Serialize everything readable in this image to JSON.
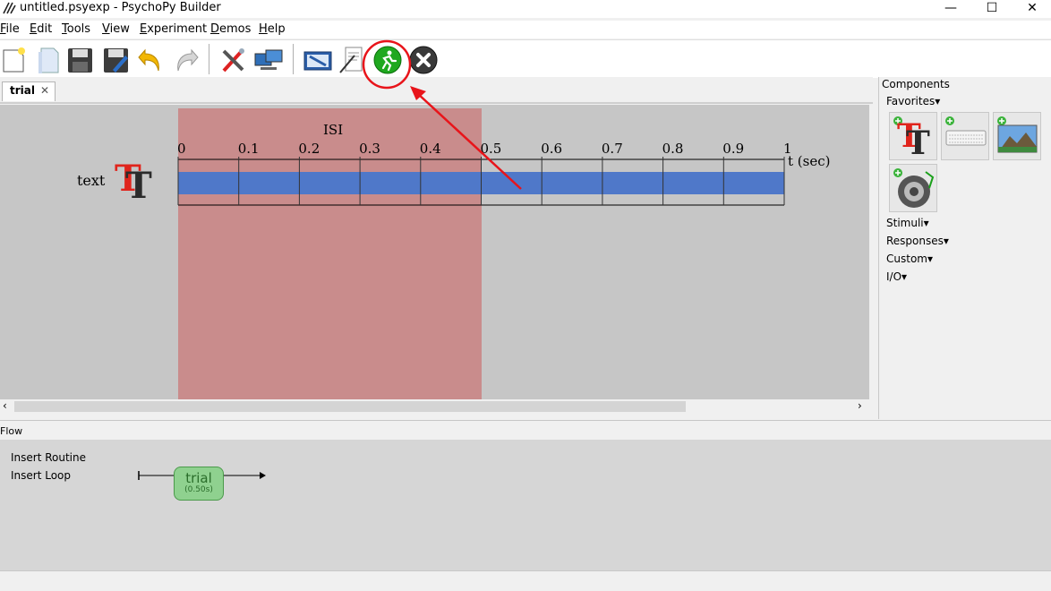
{
  "window": {
    "title": "untitled.psyexp - PsychoPy Builder",
    "minimize": "—",
    "maximize": "☐",
    "close": "✕"
  },
  "menu": [
    {
      "label": "File",
      "ul": "F",
      "rest": "ile"
    },
    {
      "label": "Edit",
      "ul": "E",
      "rest": "dit"
    },
    {
      "label": "Tools",
      "ul": "T",
      "rest": "ools"
    },
    {
      "label": "View",
      "ul": "V",
      "rest": "iew"
    },
    {
      "label": "Experiment",
      "ul": "E",
      "rest": "xperiment"
    },
    {
      "label": "Demos",
      "ul": "D",
      "rest": "emos"
    },
    {
      "label": "Help",
      "ul": "H",
      "rest": "elp"
    }
  ],
  "toolbar": {
    "icons": [
      "new-file-icon",
      "open-file-icon",
      "save-icon",
      "save-as-icon",
      "undo-icon",
      "redo-icon",
      "preferences-icon",
      "monitor-center-icon",
      "experiment-settings-icon",
      "compile-script-icon",
      "run-icon",
      "stop-icon"
    ]
  },
  "routine_tab": {
    "label": "trial",
    "close": "✕"
  },
  "timeline": {
    "region_label": "ISI",
    "component_name": "text",
    "ticks": [
      "0",
      "0.1",
      "0.2",
      "0.3",
      "0.4",
      "0.5",
      "0.6",
      "0.7",
      "0.8",
      "0.9",
      "1"
    ],
    "axis_label": "t (sec)",
    "isi_start": 0,
    "isi_end": 0.5,
    "bar_start": 0,
    "bar_end": 1
  },
  "components": {
    "header": "Components",
    "favorites": "Favorites▾",
    "categories": [
      "Stimuli▾",
      "Responses▾",
      "Custom▾",
      "I/O▾"
    ],
    "tiles": [
      "text-component-icon",
      "keyboard-component-icon",
      "image-component-icon",
      "sound-component-icon"
    ]
  },
  "flow": {
    "header": "Flow",
    "insert_routine": "Insert Routine",
    "insert_loop": "Insert Loop",
    "routine_name": "trial",
    "routine_duration": "(0.50s)"
  },
  "colors": {
    "isi": "#c98c8c",
    "component_bar": "#4f78c9",
    "annotation": "#e8141a",
    "run_button": "#1fa81f"
  }
}
